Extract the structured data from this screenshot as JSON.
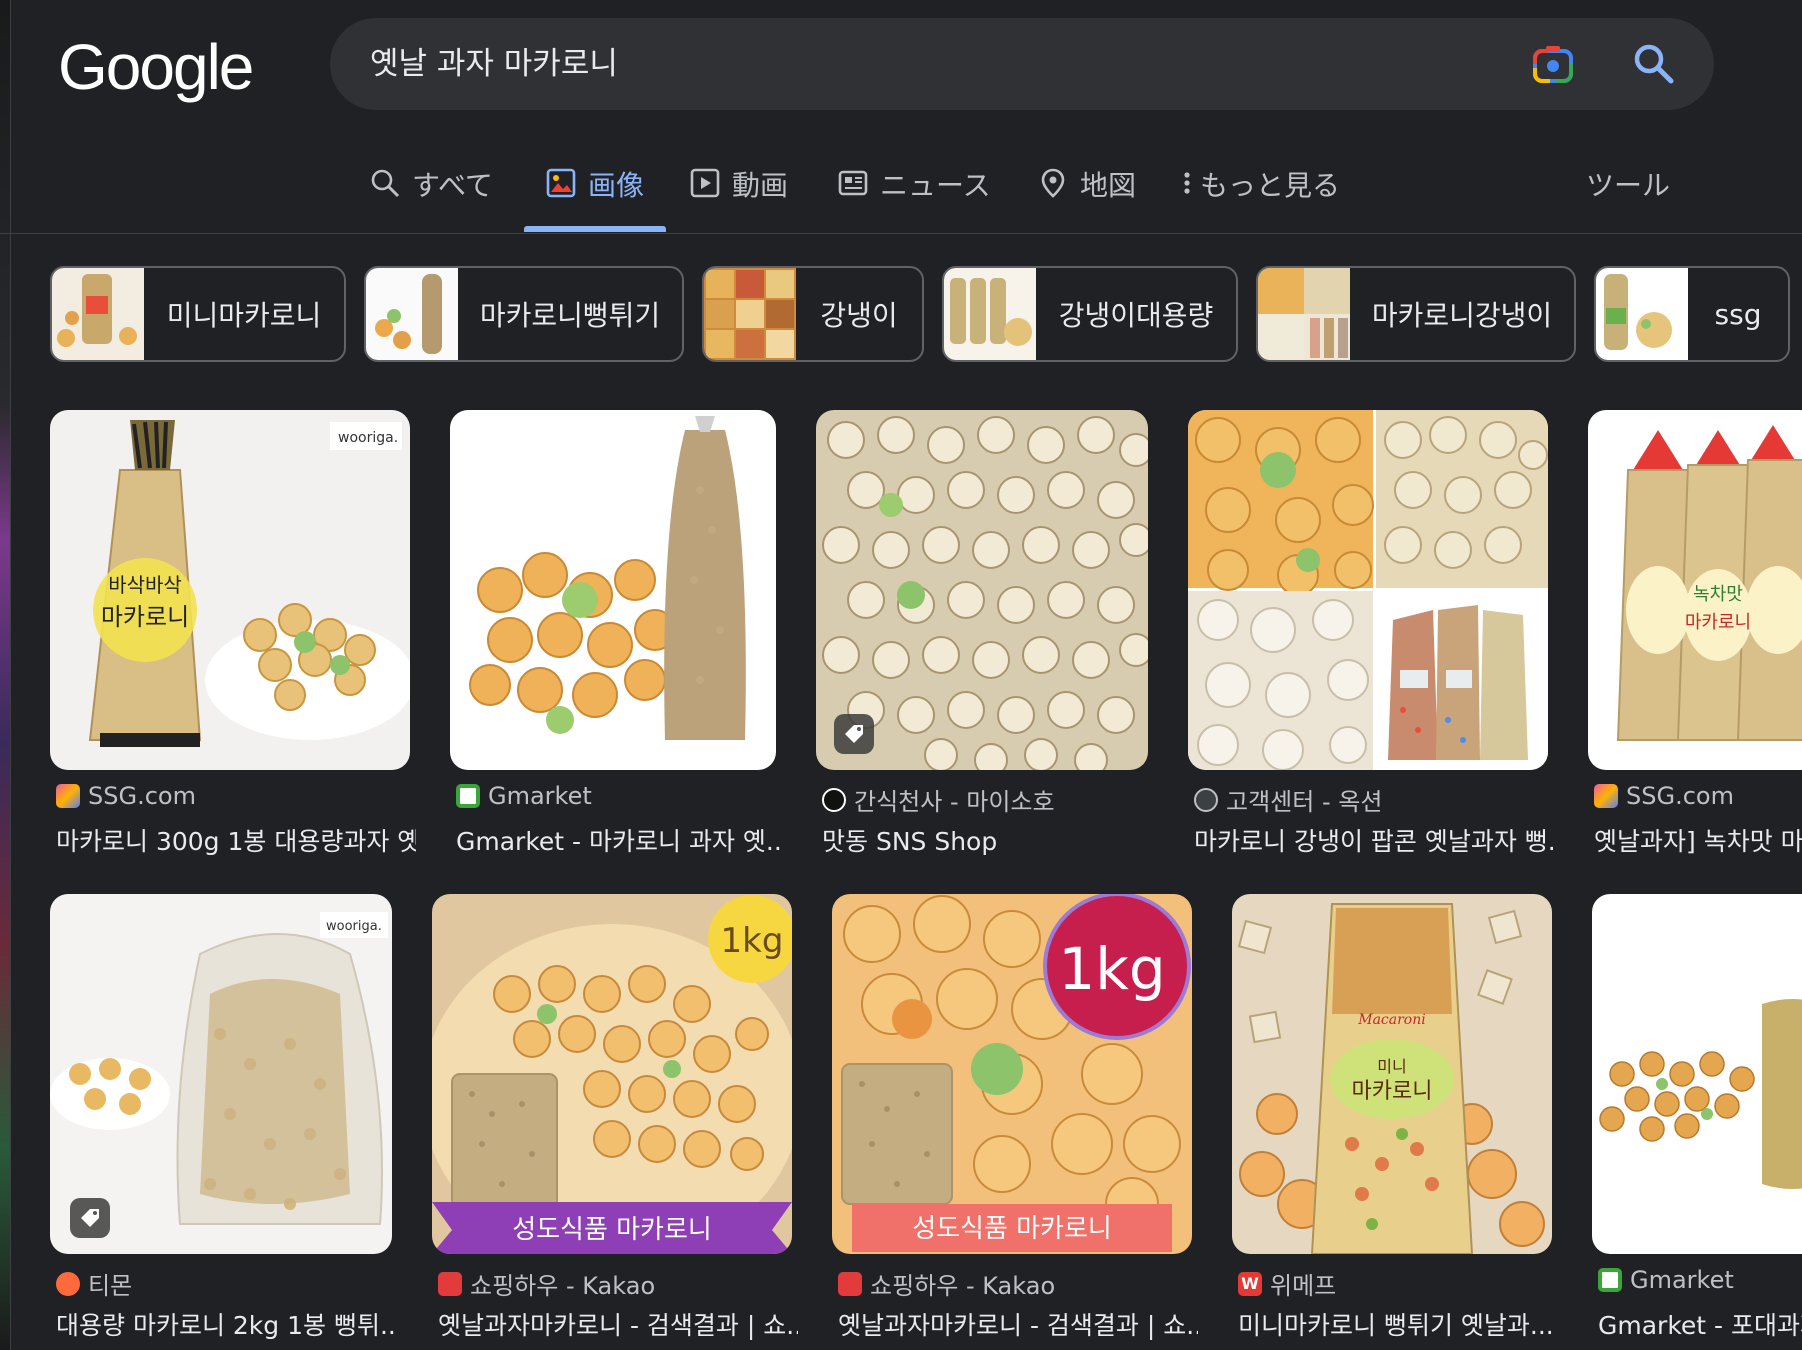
{
  "header": {
    "logo": "Google",
    "search_query": "옛날 과자 마카로니"
  },
  "tabs": [
    {
      "label": "すべて",
      "icon": "search-icon",
      "active": false
    },
    {
      "label": "画像",
      "icon": "image-icon",
      "active": true
    },
    {
      "label": "動画",
      "icon": "video-icon",
      "active": false
    },
    {
      "label": "ニュース",
      "icon": "news-icon",
      "active": false
    },
    {
      "label": "地図",
      "icon": "map-pin-icon",
      "active": false
    },
    {
      "label": "もっと見る",
      "icon": "more-vert-icon",
      "active": false
    }
  ],
  "tools_label": "ツール",
  "chips": [
    {
      "label": "미니마카로니"
    },
    {
      "label": "마카로니뻥튀기"
    },
    {
      "label": "강냉이"
    },
    {
      "label": "강냉이대용량"
    },
    {
      "label": "마카로니강냉이"
    },
    {
      "label": "ssg"
    }
  ],
  "results": [
    {
      "source": "SSG.com",
      "title": "마카로니 300g 1봉 대용량과자 옛...",
      "image_text": "wooriga.",
      "bag_text": "바삭바삭 마카로니"
    },
    {
      "source": "Gmarket",
      "title": "Gmarket - 마카로니 과자 옛..."
    },
    {
      "source": "간식천사 - 마이소호",
      "title": "맛동 SNS Shop"
    },
    {
      "source": "고객센터 - 옥션",
      "title": "마카로니 강냉이 팝콘 옛날과자 뻥..."
    },
    {
      "source": "SSG.com",
      "title": "옛날과자] 녹차맛 마카로",
      "bag_text": "녹차맛 마카로니"
    },
    {
      "source": "티몬",
      "title": "대용량 마카로니 2kg 1봉 뻥튀...",
      "image_text": "wooriga."
    },
    {
      "source": "쇼핑하우 - Kakao",
      "title": "옛날과자마카로니 - 검색결과 | 쇼...",
      "badge": "1kg",
      "banner": "성도식품 마카로니"
    },
    {
      "source": "쇼핑하우 - Kakao",
      "title": "옛날과자마카로니 - 검색결과 | 쇼...",
      "badge": "1kg",
      "banner": "성도식품 마카로니"
    },
    {
      "source": "위메프",
      "title": "미니마카로니 뻥튀기 옛날과...",
      "bag_text": "미니 마카로니",
      "bag_brand": "Macaroni"
    },
    {
      "source": "Gmarket",
      "title": "Gmarket - 포대과자"
    }
  ],
  "colors": {
    "background": "#202124",
    "search_box": "#303134",
    "accent": "#8ab4f8",
    "chip_border": "#5f6368"
  }
}
